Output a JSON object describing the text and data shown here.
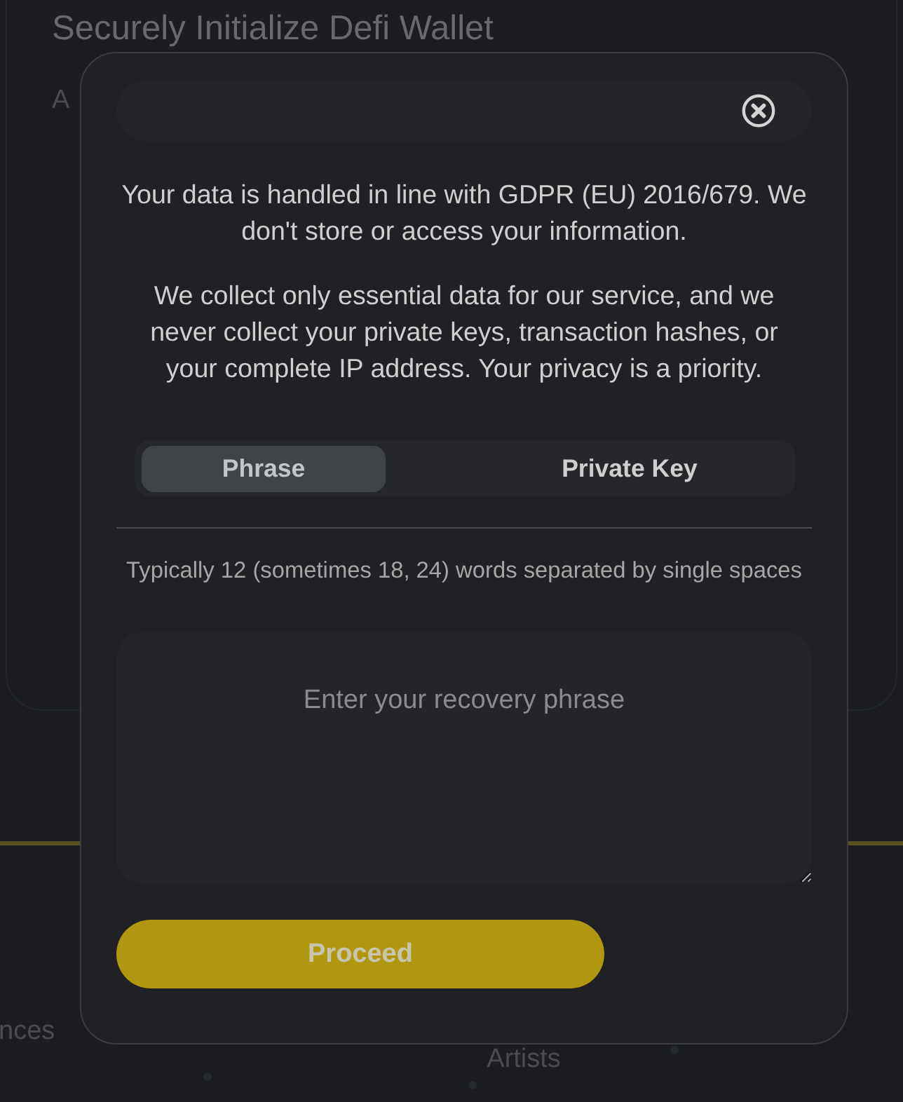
{
  "background": {
    "title": "Securely Initialize Defi Wallet",
    "subtitle": "A",
    "section_label": "nces",
    "footer_link": "Artists"
  },
  "modal": {
    "notices": [
      "Your data is handled in line with GDPR (EU) 2016/679. We don't store or access your information.",
      "We collect only essential data for our service, and we never collect your private keys, transaction hashes, or your complete IP address. Your privacy is a priority."
    ],
    "tabs": [
      {
        "label": "Phrase",
        "selected": true
      },
      {
        "label": "Private Key",
        "selected": false
      }
    ],
    "hint": "Typically 12 (sometimes 18, 24) words separated by single spaces",
    "input": {
      "placeholder": "Enter your recovery phrase"
    },
    "button": "Proceed"
  }
}
